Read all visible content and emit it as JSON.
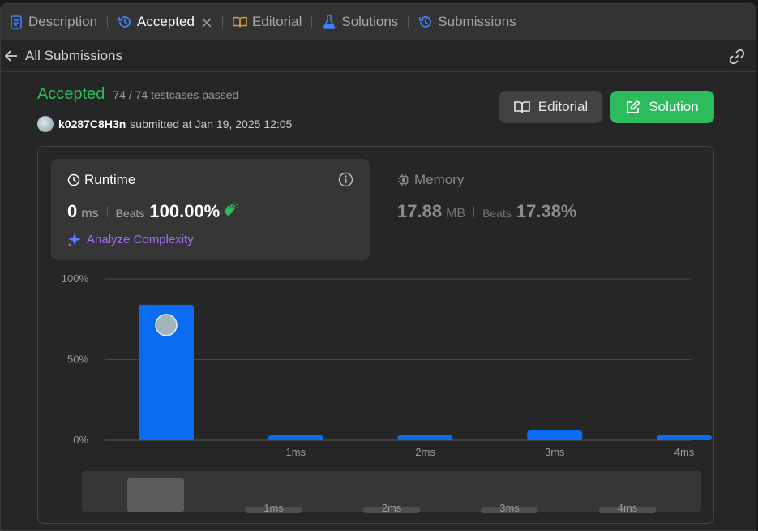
{
  "tabs": [
    {
      "label": "Description",
      "icon": "description-icon"
    },
    {
      "label": "Accepted",
      "icon": "history-icon",
      "active": true
    },
    {
      "label": "Editorial",
      "icon": "book-icon"
    },
    {
      "label": "Solutions",
      "icon": "flask-icon"
    },
    {
      "label": "Submissions",
      "icon": "history-icon"
    }
  ],
  "subheader": {
    "back_label": "All Submissions"
  },
  "result": {
    "status": "Accepted",
    "testcases": "74 / 74 testcases passed",
    "user": "k0287C8H3n",
    "submitted": "submitted at Jan 19, 2025 12:05"
  },
  "buttons": {
    "editorial": "Editorial",
    "solution": "Solution"
  },
  "runtime": {
    "label": "Runtime",
    "value": "0",
    "unit": "ms",
    "beats_label": "Beats",
    "beats": "100.00%",
    "analyze": "Analyze Complexity"
  },
  "memory": {
    "label": "Memory",
    "value": "17.88",
    "unit": "MB",
    "beats_label": "Beats",
    "beats": "17.38%"
  },
  "colors": {
    "accent_green": "#2cbb5d",
    "bar_blue": "#0a6cf0",
    "purple": "#a96bff"
  },
  "chart_data": {
    "type": "bar",
    "categories": [
      "0ms",
      "1ms",
      "2ms",
      "3ms",
      "4ms"
    ],
    "tick_labels": [
      "",
      "1ms",
      "2ms",
      "3ms",
      "4ms"
    ],
    "values": [
      84,
      3,
      3,
      6,
      3
    ],
    "ylim": [
      0,
      100
    ],
    "yticks": [
      0,
      50,
      100
    ],
    "ytick_labels": [
      "0%",
      "50%",
      "100%"
    ],
    "highlight_index": 0,
    "overview": {
      "tick_labels": [
        "",
        "1ms",
        "2ms",
        "3ms",
        "4ms"
      ],
      "values": [
        84,
        3,
        3,
        3,
        3
      ]
    }
  }
}
